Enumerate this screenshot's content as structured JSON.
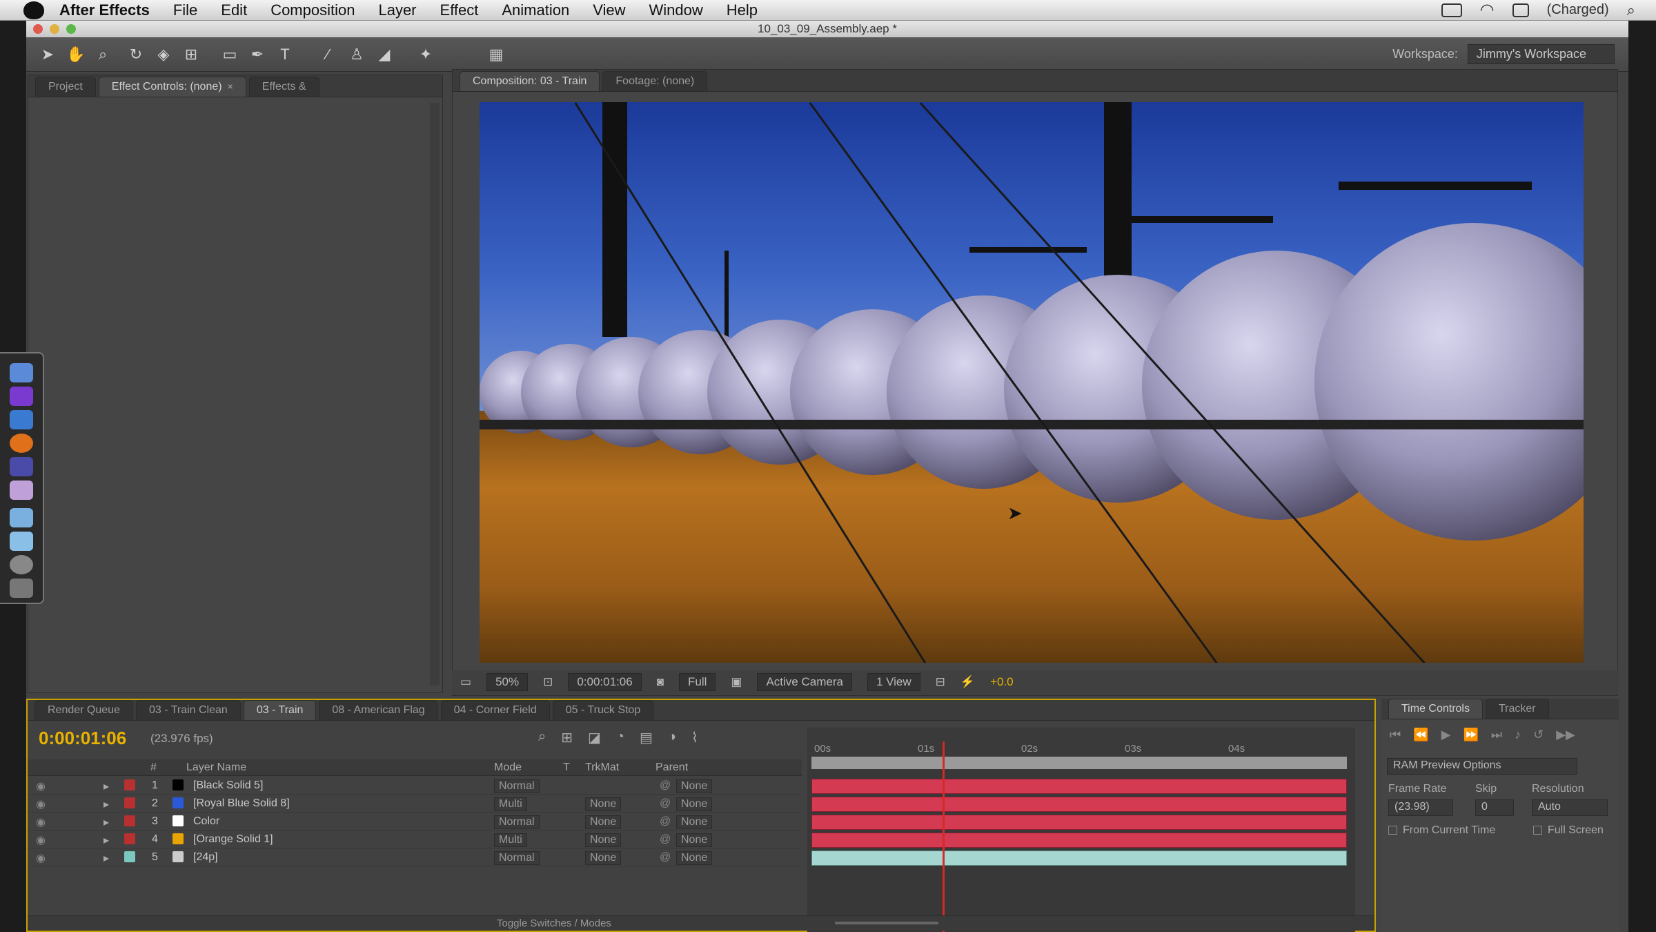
{
  "menubar": {
    "app_name": "After Effects",
    "items": [
      "File",
      "Edit",
      "Composition",
      "Layer",
      "Effect",
      "Animation",
      "View",
      "Window",
      "Help"
    ],
    "battery": "(Charged)"
  },
  "window": {
    "title": "10_03_09_Assembly.aep *"
  },
  "workspace": {
    "label": "Workspace:",
    "value": "Jimmy's Workspace"
  },
  "left_panel": {
    "tabs": [
      {
        "label": "Project"
      },
      {
        "label": "Effect Controls: (none)"
      },
      {
        "label": "Effects &"
      }
    ]
  },
  "comp_panel": {
    "tabs": [
      {
        "label": "Composition: 03 - Train"
      },
      {
        "label": "Footage: (none)"
      }
    ],
    "footer": {
      "zoom": "50%",
      "timecode": "0:00:01:06",
      "resolution": "Full",
      "camera": "Active Camera",
      "views": "1 View",
      "exposure": "+0.0"
    }
  },
  "timeline": {
    "tabs": [
      {
        "label": "Render Queue"
      },
      {
        "label": "03 - Train Clean"
      },
      {
        "label": "03 - Train"
      },
      {
        "label": "08 - American Flag"
      },
      {
        "label": "04 - Corner Field"
      },
      {
        "label": "05 - Truck Stop"
      }
    ],
    "timecode": "0:00:01:06",
    "fps": "(23.976 fps)",
    "columns": {
      "num": "#",
      "name": "Layer Name",
      "mode": "Mode",
      "t": "T",
      "trkmat": "TrkMat",
      "parent": "Parent"
    },
    "ruler": [
      "00s",
      "01s",
      "02s",
      "03s",
      "04s"
    ],
    "layers": [
      {
        "num": "1",
        "name": "[Black Solid 5]",
        "mode": "Normal",
        "trkmat": "",
        "parent": "None",
        "swatch": "#000000",
        "label": "#b83030"
      },
      {
        "num": "2",
        "name": "[Royal Blue Solid 8]",
        "mode": "Multi",
        "trkmat": "None",
        "parent": "None",
        "swatch": "#2a5ad8",
        "label": "#b83030"
      },
      {
        "num": "3",
        "name": "Color",
        "mode": "Normal",
        "trkmat": "None",
        "parent": "None",
        "swatch": "#ffffff",
        "label": "#b83030"
      },
      {
        "num": "4",
        "name": "[Orange Solid 1]",
        "mode": "Multi",
        "trkmat": "None",
        "parent": "None",
        "swatch": "#e8a400",
        "label": "#b83030"
      },
      {
        "num": "5",
        "name": "[24p]",
        "mode": "Normal",
        "trkmat": "None",
        "parent": "None",
        "swatch": "#cccccc",
        "label": "#7ac8c0"
      }
    ],
    "footer_label": "Toggle Switches / Modes"
  },
  "time_controls": {
    "tabs": [
      {
        "label": "Time Controls"
      },
      {
        "label": "Tracker"
      }
    ],
    "ram_preview": "RAM Preview Options",
    "frame_rate_label": "Frame Rate",
    "skip_label": "Skip",
    "resolution_label": "Resolution",
    "frame_rate": "(23.98)",
    "skip": "0",
    "resolution": "Auto",
    "from_current_time": "From Current Time",
    "full_screen": "Full Screen"
  },
  "colors": {
    "accent": "#e8b200",
    "bar_red": "#d43a52",
    "bar_teal": "#a6d6d0",
    "cti": "#d42a2a"
  },
  "icons": [
    "apple-icon",
    "selection-tool-icon",
    "hand-tool-icon",
    "zoom-tool-icon",
    "rotate-tool-icon",
    "camera-tool-icon",
    "pan-behind-icon",
    "rectangle-tool-icon",
    "pen-tool-icon",
    "type-tool-icon",
    "brush-tool-icon",
    "clone-stamp-icon",
    "eraser-icon",
    "puppet-pin-icon",
    "snapping-icon",
    "wifi-icon",
    "battery-icon",
    "spotlight-icon"
  ]
}
